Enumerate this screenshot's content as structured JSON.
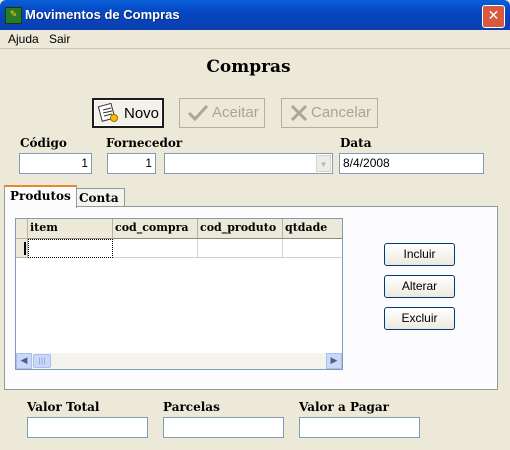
{
  "window": {
    "title": "Movimentos de Compras",
    "close_glyph": "✕"
  },
  "menu": {
    "items": [
      "Ajuda",
      "Sair"
    ]
  },
  "heading": "Compras",
  "toolbar": {
    "novo": "Novo",
    "aceitar": "Aceitar",
    "cancelar": "Cancelar"
  },
  "form": {
    "codigo_label": "Código",
    "codigo_value": "1",
    "fornecedor_label": "Fornecedor",
    "fornecedor_value": "1",
    "fornecedor_name": "",
    "data_label": "Data",
    "data_value": "8/4/2008"
  },
  "tabs": [
    "Produtos",
    "Conta"
  ],
  "grid": {
    "columns": [
      "item",
      "cod_compra",
      "cod_produto",
      "qtdade"
    ]
  },
  "side_buttons": {
    "incluir": "Incluir",
    "alterar": "Alterar",
    "excluir": "Excluir"
  },
  "totals": {
    "valor_total_label": "Valor Total",
    "parcelas_label": "Parcelas",
    "valor_pagar_label": "Valor a Pagar"
  },
  "icons": [
    "app-icon",
    "close-icon",
    "document-icon",
    "check-icon",
    "cancel-x-icon",
    "chevron-down-icon",
    "scroll-left-icon",
    "scroll-right-icon"
  ]
}
